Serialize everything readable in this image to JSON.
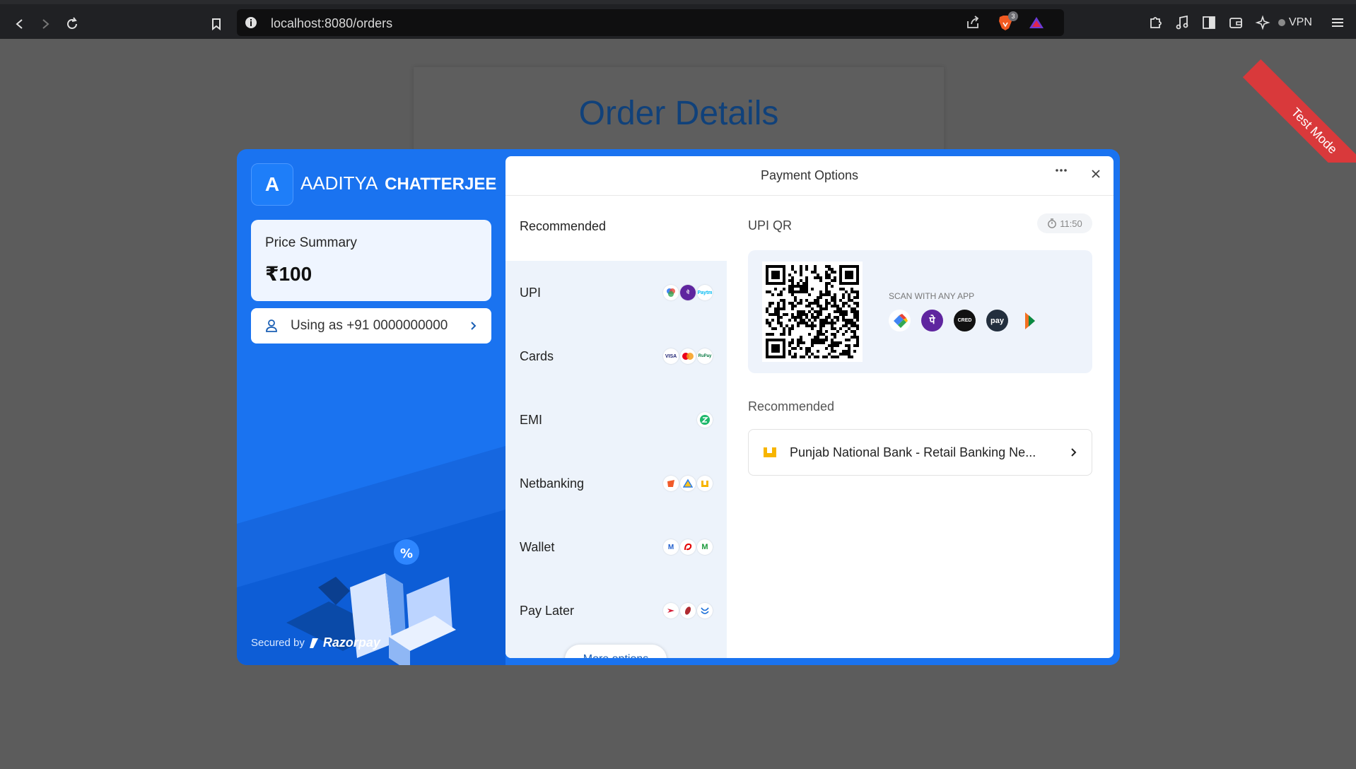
{
  "browser": {
    "url": "localhost:8080/orders",
    "shield_count": "3",
    "vpn_label": "VPN"
  },
  "page": {
    "title": "Order Details",
    "ribbon": "Test Mode"
  },
  "checkout": {
    "merchant_initial": "A",
    "merchant_first": "AADITYA",
    "merchant_last": "CHATTERJEE",
    "price_label": "Price Summary",
    "price_value": "₹100",
    "user_label": "Using as +91 0000000000",
    "secured_by": "Secured by",
    "brand": "Razorpay",
    "header_title": "Payment Options",
    "recommended_label": "Recommended",
    "methods": [
      {
        "label": "UPI",
        "icons": [
          "google-pay",
          "phonepe",
          "paytm"
        ]
      },
      {
        "label": "Cards",
        "icons": [
          "visa",
          "mastercard",
          "rupay"
        ]
      },
      {
        "label": "EMI",
        "icons": [
          "zestmoney"
        ]
      },
      {
        "label": "Netbanking",
        "icons": [
          "bank-1",
          "bank-2",
          "pnb"
        ]
      },
      {
        "label": "Wallet",
        "icons": [
          "mobikwik",
          "airtel",
          "m-wallet"
        ]
      },
      {
        "label": "Pay Later",
        "icons": [
          "lazypay",
          "icici",
          "simpl"
        ]
      }
    ],
    "more_options": "More options",
    "upi_qr_title": "UPI QR",
    "timer": "11:50",
    "scan_label": "SCAN WITH ANY APP",
    "qr_apps": [
      "google-pay",
      "phonepe",
      "cred",
      "amazon-pay",
      "bhim"
    ],
    "cred_text": "CRED",
    "amazon_text": "pay",
    "recommended_section": "Recommended",
    "bank_name": "Punjab National Bank - Retail Banking Ne...",
    "card_texts": {
      "visa": "VISA",
      "rupay": "RuPay",
      "paytm": "Paytm"
    }
  },
  "colors": {
    "brand_blue": "#1a73f0",
    "ribbon_red": "#d9393b",
    "title_blue": "#10417a"
  }
}
